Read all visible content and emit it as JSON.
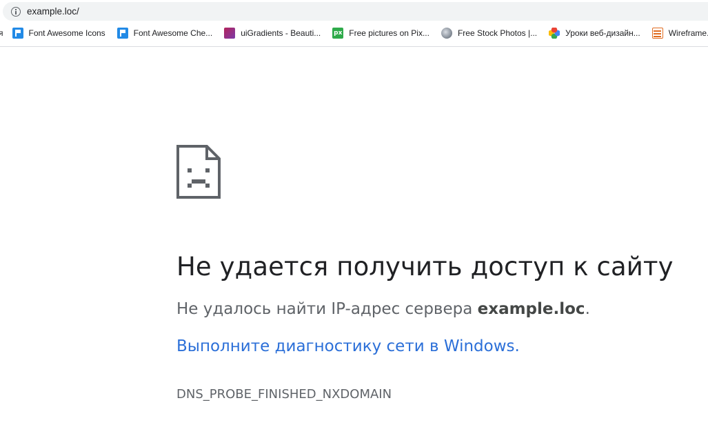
{
  "address_bar": {
    "url": "example.loc/"
  },
  "bookmarks": [
    {
      "label": "я",
      "icon": "none"
    },
    {
      "label": "Font Awesome Icons",
      "icon": "flag-icon"
    },
    {
      "label": "Font Awesome Che...",
      "icon": "flag-icon"
    },
    {
      "label": "uiGradients - Beauti...",
      "icon": "gradient-icon"
    },
    {
      "label": "Free pictures on Pix...",
      "icon": "pixabay-icon"
    },
    {
      "label": "Free Stock Photos |...",
      "icon": "globe-icon"
    },
    {
      "label": "Уроки веб-дизайн...",
      "icon": "flower-icon"
    },
    {
      "label": "Wireframe...",
      "icon": "wireframe-icon"
    }
  ],
  "pixabay_glyph": "px",
  "error": {
    "title": "Не удается получить доступ к сайту",
    "description_prefix": "Не удалось найти IP-адрес сервера ",
    "description_host": "example.loc",
    "description_suffix": ".",
    "diagnostics_link": "Выполните диагностику сети в Windows",
    "diagnostics_suffix": ".",
    "code": "DNS_PROBE_FINISHED_NXDOMAIN"
  },
  "colors": {
    "title": "#202124",
    "text": "#5f6368",
    "link": "#2b6fd8",
    "omnibox_bg": "#f1f3f4"
  }
}
